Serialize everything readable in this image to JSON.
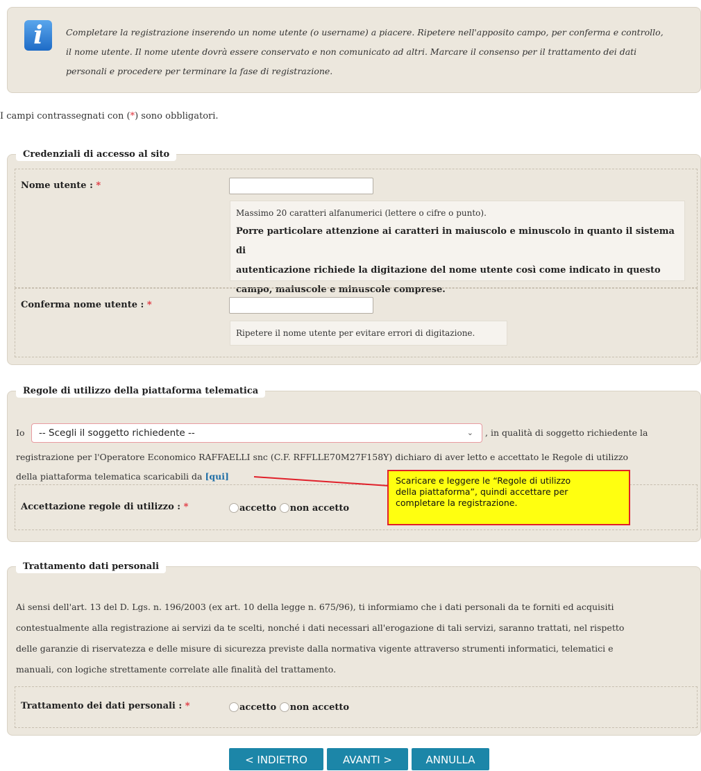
{
  "info": {
    "line1": "Completare la registrazione inserendo un nome utente (o username) a piacere. Ripetere nell'apposito campo, per conferma e controllo,",
    "line2": "il nome utente. Il nome utente dovrà essere conservato e non comunicato ad altri. Marcare il consenso per il trattamento dei dati",
    "line3": "personali e procedere per terminare la fase di registrazione."
  },
  "mandatory_note": {
    "prefix": "I campi contrassegnati con (",
    "star": "*",
    "suffix": ") sono obbligatori."
  },
  "credentials": {
    "legend": "Credenziali di accesso al sito",
    "username_label": "Nome utente :",
    "username_value": "",
    "username_hint_line": "Massimo 20 caratteri alfanumerici (lettere o cifre o punto).",
    "username_hint_bold1": "Porre particolare attenzione ai caratteri in maiuscolo e minuscolo in quanto il sistema di",
    "username_hint_bold2": "autenticazione richiede la digitazione del nome utente così come indicato in questo",
    "username_hint_bold3": "campo, maiuscole e minuscole comprese.",
    "confirm_label": "Conferma nome utente :",
    "confirm_value": "",
    "confirm_hint": "Ripetere il nome utente per evitare errori di digitazione."
  },
  "rules": {
    "legend": "Regole di utilizzo della piattaforma telematica",
    "io": "Io",
    "select_value": "-- Scegli il soggetto richiedente --",
    "after_select": ", in qualità di soggetto richiedente la",
    "line2": "registrazione per l'Operatore Economico RAFFAELLI snc (C.F. RFFLLE70M27F158Y) dichiaro di aver letto e accettato le Regole di utilizzo",
    "line3": "della piattaforma telematica scaricabili da",
    "link": "[qui]",
    "accept_label": "Accettazione regole di utilizzo :",
    "opt_accept": "accetto",
    "opt_reject": "non accetto"
  },
  "callout": {
    "line1": "Scaricare e leggere le “Regole di utilizzo",
    "line2": "della piattaforma”, quindi accettare per",
    "line3": "completare la registrazione.",
    "border_color": "#e0202a",
    "fill_color": "#ffff10"
  },
  "privacy": {
    "legend": "Trattamento dati personali",
    "line1": "Ai sensi dell'art. 13 del D. Lgs. n. 196/2003 (ex art. 10 della legge n. 675/96), ti informiamo che i dati personali da te forniti ed acquisiti",
    "line2": "contestualmente alla registrazione ai servizi da te scelti, nonché i dati necessari all'erogazione di tali servizi, saranno trattati, nel rispetto",
    "line3": "delle garanzie di riservatezza e delle misure di sicurezza previste dalla normativa vigente attraverso strumenti informatici, telematici e",
    "line4": "manuali, con logiche strettamente correlate alle finalità del trattamento.",
    "consent_label": "Trattamento dei dati personali :",
    "opt_accept": "accetto",
    "opt_reject": "non accetto"
  },
  "buttons": {
    "back": "< INDIETRO",
    "next": "AVANTI >",
    "cancel": "ANNULLA"
  },
  "colors": {
    "panel": "#ece7dd",
    "button": "#1c86a8",
    "required": "#e0303a",
    "link": "#1e6ea6"
  }
}
